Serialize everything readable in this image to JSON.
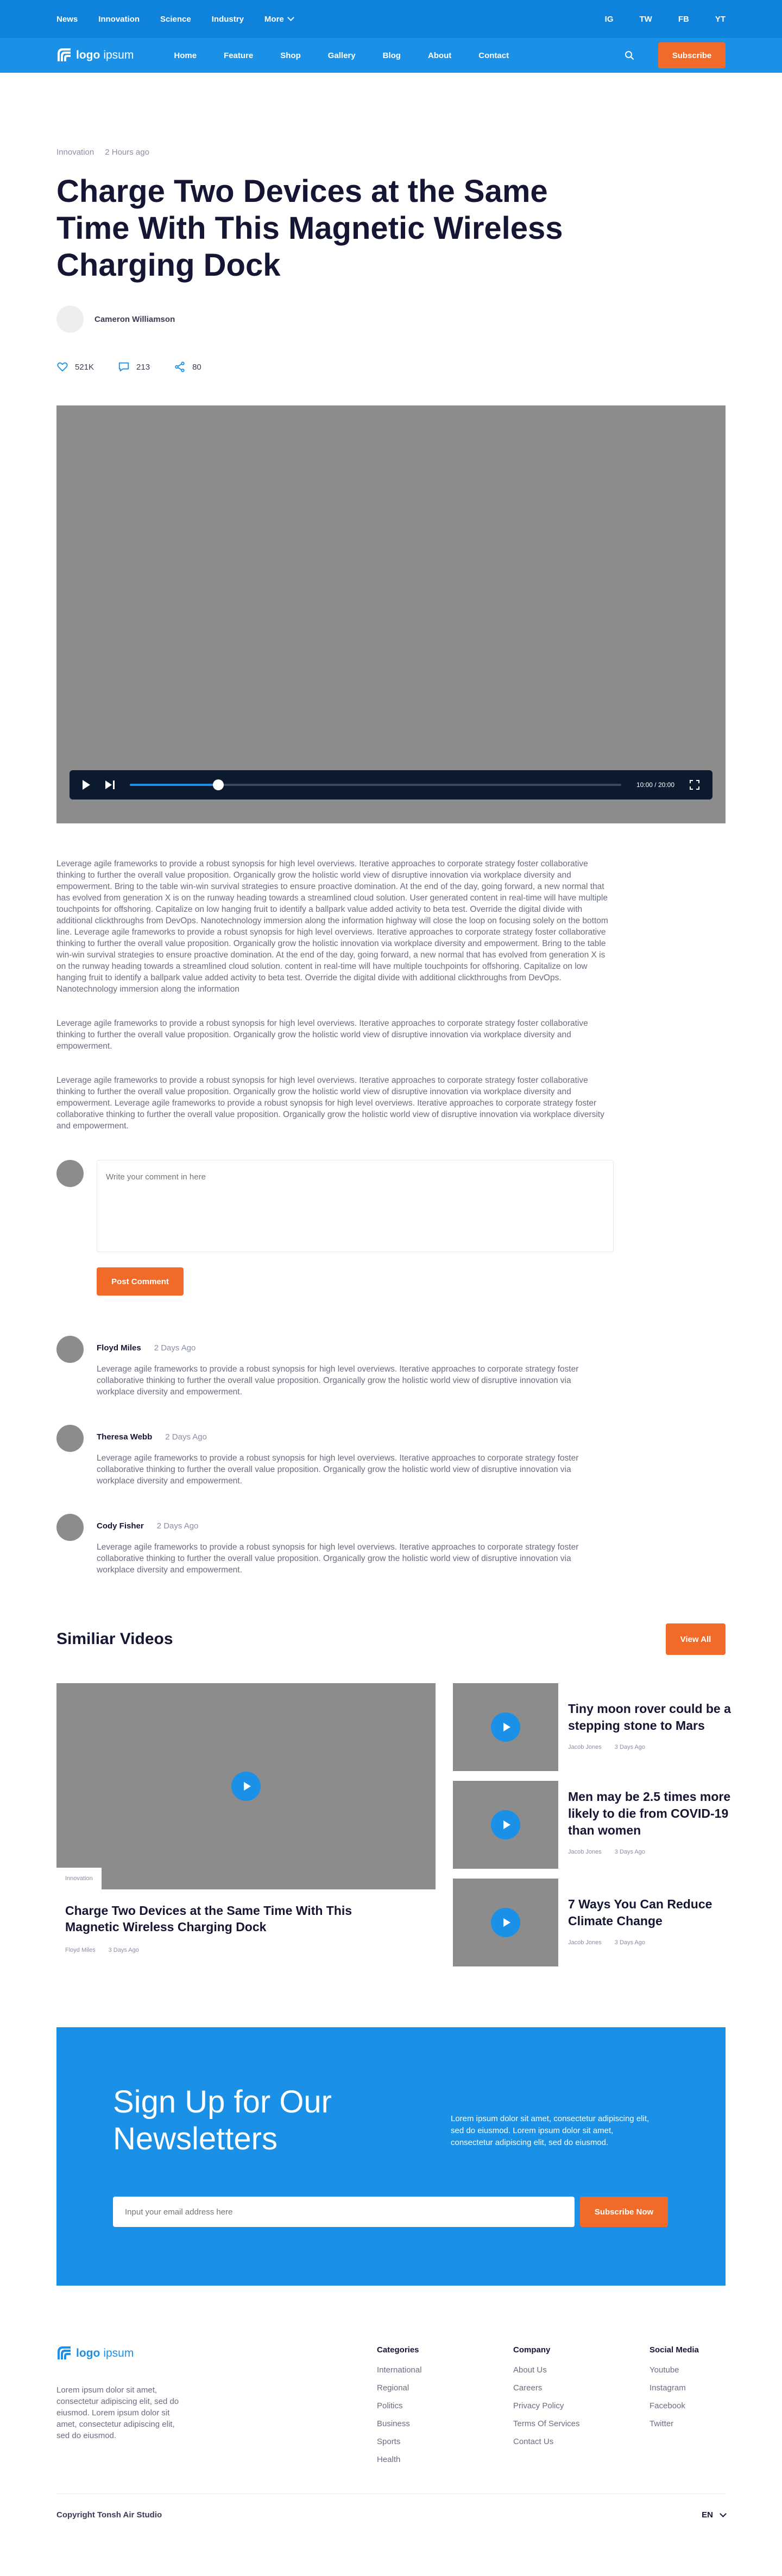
{
  "colors": {
    "primary": "#1a90e6",
    "topbar": "#0f83db",
    "accent": "#f26a28",
    "placeholder": "#8c8c8c"
  },
  "topbar": {
    "links": [
      "News",
      "Innovation",
      "Science",
      "Industry"
    ],
    "more_label": "More",
    "social": [
      "IG",
      "TW",
      "FB",
      "YT"
    ]
  },
  "nav": {
    "logo_bold": "logo",
    "logo_thin": "ipsum",
    "items": [
      "Home",
      "Feature",
      "Shop",
      "Gallery",
      "Blog",
      "About",
      "Contact"
    ],
    "search_icon": "search-icon",
    "subscribe_label": "Subscribe"
  },
  "article": {
    "category": "Innovation",
    "time_ago": "2 Hours ago",
    "title": "Charge Two Devices at the Same Time With This Magnetic Wireless Charging Dock",
    "author": "Cameron Williamson",
    "likes": "521K",
    "comments": "213",
    "shares": "80"
  },
  "video": {
    "time": "10:00 / 20:00",
    "progress": 0.18
  },
  "body": {
    "paragraphs": [
      "Leverage agile frameworks to provide a robust synopsis for high level overviews. Iterative approaches to corporate strategy foster collaborative thinking to further the overall value proposition. Organically grow the holistic world view of disruptive innovation via workplace diversity and empowerment. Bring to the table win-win survival strategies to ensure proactive domination. At the end of the day, going forward, a new normal that has evolved from generation X is on the runway heading towards a streamlined cloud solution. User generated content in real-time will have multiple touchpoints for offshoring. Capitalize on low hanging fruit to identify a ballpark value added activity to beta test. Override the digital divide with additional clickthroughs from DevOps. Nanotechnology immersion along the information highway will close the loop on focusing solely on the bottom line.  Leverage agile frameworks to provide a robust synopsis for high level overviews. Iterative approaches to corporate strategy foster collaborative thinking to further the overall value proposition. Organically grow the holistic innovation via workplace diversity and empowerment. Bring to the table win-win survival strategies to ensure proactive domination. At the end of the day, going forward, a new normal that has evolved from generation X is on the runway heading towards a streamlined cloud solution. content in real-time will have multiple touchpoints for offshoring. Capitalize on low hanging fruit to identify a ballpark value added activity to beta test. Override the digital divide with additional clickthroughs from DevOps. Nanotechnology immersion along the information",
      "Leverage agile frameworks to provide a robust synopsis for high level overviews. Iterative approaches to corporate strategy foster collaborative thinking to further the overall value proposition. Organically grow the holistic world view of disruptive innovation via workplace diversity and empowerment.",
      "Leverage agile frameworks to provide a robust synopsis for high level overviews. Iterative approaches to corporate strategy foster collaborative thinking to further the overall value proposition. Organically grow the holistic world view of disruptive innovation via workplace diversity and empowerment. Leverage agile frameworks to provide a robust synopsis for high level overviews. Iterative approaches to corporate strategy foster collaborative thinking to further the overall value proposition. Organically grow the holistic world view of disruptive innovation via workplace diversity and empowerment."
    ]
  },
  "comment_form": {
    "placeholder": "Write your comment in here",
    "post_label": "Post Comment"
  },
  "comments": [
    {
      "name": "Floyd Miles",
      "date": "2 Days Ago",
      "text": "Leverage agile frameworks to provide a robust synopsis for high level overviews. Iterative approaches to corporate strategy foster collaborative thinking to further the overall value proposition. Organically grow the holistic world view of disruptive innovation via workplace diversity and empowerment."
    },
    {
      "name": "Theresa Webb",
      "date": "2 Days Ago",
      "text": "Leverage agile frameworks to provide a robust synopsis for high level overviews. Iterative approaches to corporate strategy foster collaborative thinking to further the overall value proposition. Organically grow the holistic world view of disruptive innovation via workplace diversity and empowerment."
    },
    {
      "name": "Cody Fisher",
      "date": "2 Days Ago",
      "text": "Leverage agile frameworks to provide a robust synopsis for high level overviews. Iterative approaches to corporate strategy foster collaborative thinking to further the overall value proposition. Organically grow the holistic world view of disruptive innovation via workplace diversity and empowerment."
    }
  ],
  "similar": {
    "heading": "Similiar Videos",
    "view_all": "View All",
    "featured": {
      "tag": "Innovation",
      "title": "Charge Two Devices at the Same Time With This Magnetic Wireless Charging Dock",
      "author": "Floyd Miles",
      "date": "3 Days Ago"
    },
    "side": [
      {
        "title": "Tiny moon rover could be a stepping stone to Mars",
        "author": "Jacob Jones",
        "date": "3 Days Ago"
      },
      {
        "title": "Men may be 2.5 times more likely to die from COVID-19 than women",
        "author": "Jacob Jones",
        "date": "3 Days Ago"
      },
      {
        "title": "7 Ways You Can Reduce Climate Change",
        "author": "Jacob Jones",
        "date": "3 Days Ago"
      }
    ]
  },
  "newsletter": {
    "title": "Sign Up for Our Newsletters",
    "desc": "Lorem ipsum dolor sit amet, consectetur adipiscing elit, sed do eiusmod. Lorem ipsum dolor sit amet, consectetur adipiscing elit, sed do eiusmod.",
    "placeholder": "Input your email address here",
    "button": "Subscribe Now"
  },
  "footer": {
    "about": "Lorem ipsum dolor sit amet, consectetur adipiscing elit, sed do eiusmod. Lorem ipsum dolor sit amet, consectetur adipiscing elit, sed do eiusmod.",
    "columns": [
      {
        "title": "Categories",
        "items": [
          "International",
          "Regional",
          "Politics",
          "Business",
          "Sports",
          "Health"
        ]
      },
      {
        "title": "Company",
        "items": [
          "About Us",
          "Careers",
          "Privacy Policy",
          "Terms Of Services",
          "Contact Us"
        ]
      },
      {
        "title": "Social Media",
        "items": [
          "Youtube",
          "Instagram",
          "Facebook",
          "Twitter"
        ]
      }
    ],
    "copyright": "Copyright Tonsh Air Studio",
    "language": "EN"
  }
}
